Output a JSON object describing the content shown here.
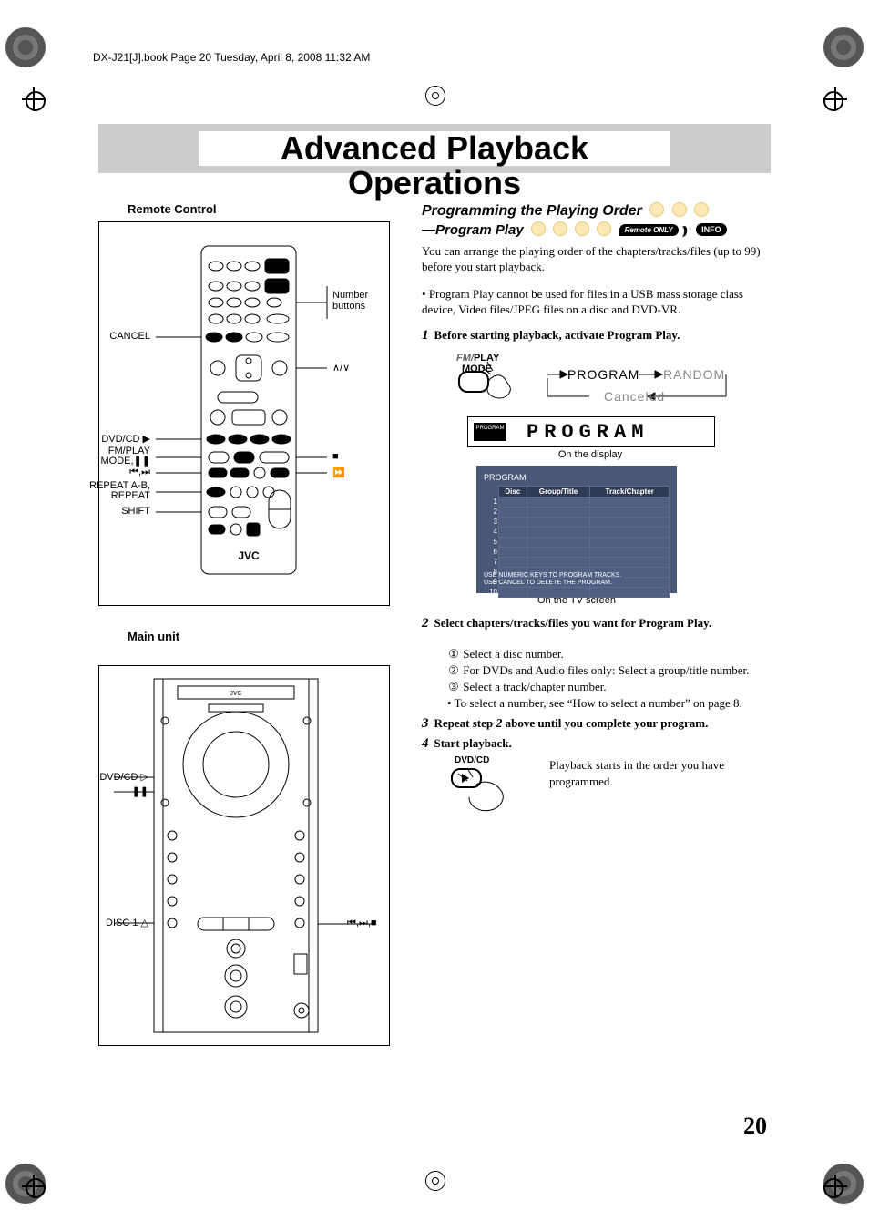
{
  "book_line": "DX-J21[J].book  Page 20  Tuesday, April 8, 2008  11:32 AM",
  "page_title": "Advanced Playback Operations",
  "left": {
    "remote_title": "Remote Control",
    "main_title": "Main unit",
    "remote_labels": {
      "number_buttons": "Number buttons",
      "cancel": "CANCEL",
      "updown": "∧/∨",
      "dvdcd_play": "DVD/CD ▶",
      "fmplay_mode_pause": "FM/PLAY MODE,❚❚",
      "prev_next": "⏮,⏭",
      "stop": "■",
      "fwd": "⏩",
      "repeat": "REPEAT A-B, REPEAT",
      "shift": "SHIFT",
      "brand": "JVC"
    },
    "main_labels": {
      "dvdcd": "DVD/CD ▷",
      "pause": "❚❚",
      "disc1": "DISC 1 △",
      "transport": "⏮,⏭,■"
    }
  },
  "right": {
    "section_title": "Programming the Playing Order",
    "subtitle": "—Program Play",
    "remote_only": "Remote ONLY",
    "info_badge": "INFO",
    "intro": "You can arrange the playing order of the chapters/tracks/files (up to 99) before you start playback.",
    "note": "Program Play cannot be used for files in a USB mass storage class device, Video files/JPEG files on a disc and DVD-VR.",
    "steps": {
      "s1": "Before starting playback, activate Program Play.",
      "mode_lbl_fm": "FM/",
      "mode_lbl_play": "PLAY",
      "mode_lbl_mode": "MODE",
      "flow_program": "PROGRAM",
      "flow_random": "RANDOM",
      "flow_canceled": "Canceled",
      "display_bar": "PROGRAM",
      "display_seg": "PROGRAM",
      "display_caption": "On the display",
      "tv_hdr": "PROGRAM",
      "tv_cols": [
        "Disc",
        "Group/Title",
        "Track/Chapter"
      ],
      "tv_foot1": "USE NUMERIC KEYS TO PROGRAM TRACKS.",
      "tv_foot2": "USE CANCEL TO DELETE THE PROGRAM.",
      "tv_caption": "On the TV screen",
      "s2": "Select chapters/tracks/files you want for Program Play.",
      "s2_1": "Select a disc number.",
      "s2_2": "For DVDs and Audio files only: Select a group/title number.",
      "s2_3": "Select a track/chapter number.",
      "s2_note": "To select a number, see “How to select a number” on page 8.",
      "s3_a": "Repeat step ",
      "s3_num": "2",
      "s3_b": " above until you complete your program.",
      "s4": "Start playback.",
      "dvdcd_lbl": "DVD/CD",
      "s4_body": "Playback starts in the order you have programmed."
    }
  },
  "page_number": "20"
}
